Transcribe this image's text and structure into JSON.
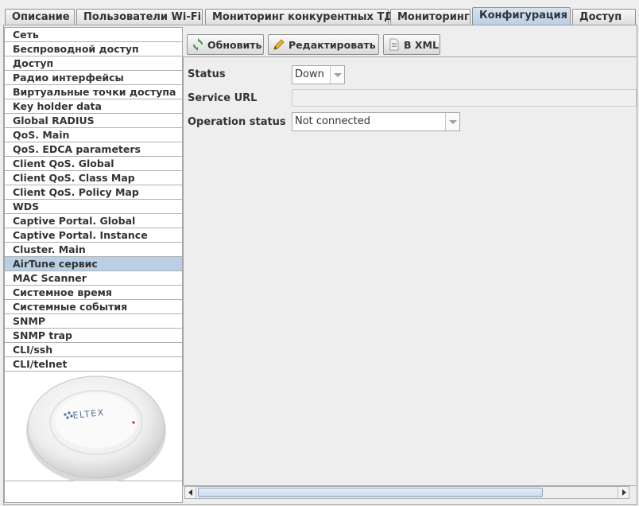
{
  "tabs": [
    {
      "label": "Описание"
    },
    {
      "label": "Пользователи Wi-Fi"
    },
    {
      "label": "Мониторинг конкурентных ТД"
    },
    {
      "label": "Мониторинг"
    },
    {
      "label": "Конфигурация",
      "active": true
    },
    {
      "label": "Доступ"
    }
  ],
  "sidebar": {
    "items": [
      {
        "label": "Сеть"
      },
      {
        "label": "Беспроводной доступ"
      },
      {
        "label": "Доступ"
      },
      {
        "label": "Радио интерфейсы"
      },
      {
        "label": "Виртуальные точки доступа"
      },
      {
        "label": "Key holder data"
      },
      {
        "label": "Global RADIUS"
      },
      {
        "label": "QoS. Main"
      },
      {
        "label": "QoS. EDCA parameters"
      },
      {
        "label": "Client QoS. Global"
      },
      {
        "label": "Client QoS. Class Map"
      },
      {
        "label": "Client QoS. Policy Map"
      },
      {
        "label": "WDS"
      },
      {
        "label": "Captive Portal. Global"
      },
      {
        "label": "Captive Portal. Instance"
      },
      {
        "label": "Cluster. Main"
      },
      {
        "label": "AirTune сервис",
        "selected": true
      },
      {
        "label": "MAC Scanner"
      },
      {
        "label": "Системное время"
      },
      {
        "label": "Системные события"
      },
      {
        "label": "SNMP"
      },
      {
        "label": "SNMP trap"
      },
      {
        "label": "CLI/ssh"
      },
      {
        "label": "CLI/telnet"
      }
    ],
    "device_logo": "ELTEX"
  },
  "toolbar": {
    "refresh_label": "Обновить",
    "edit_label": "Редактировать",
    "xml_label": "В XML"
  },
  "form": {
    "status_label": "Status",
    "status_value": "Down",
    "service_url_label": "Service URL",
    "service_url_value": "",
    "operation_status_label": "Operation status",
    "operation_status_value": "Not connected"
  },
  "colors": {
    "selection": "#b8cfe5",
    "accent": "#6a8fb8"
  }
}
